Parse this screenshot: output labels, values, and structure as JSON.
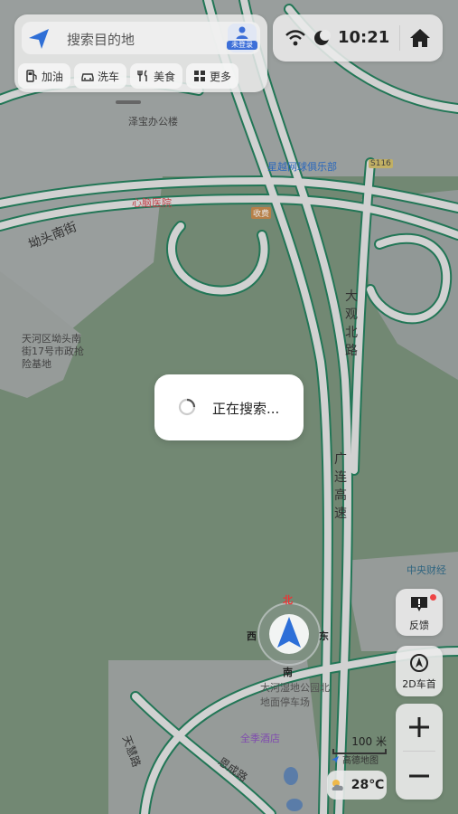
{
  "search": {
    "placeholder": "搜索目的地",
    "avatar_badge": "未登录"
  },
  "categories": [
    {
      "label": "加油",
      "icon": "fuel-icon"
    },
    {
      "label": "洗车",
      "icon": "car-wash-icon"
    },
    {
      "label": "美食",
      "icon": "food-icon"
    },
    {
      "label": "更多",
      "icon": "more-grid-icon"
    }
  ],
  "status": {
    "time": "10:21"
  },
  "loading": {
    "text": "正在搜索..."
  },
  "side": {
    "feedback": "反馈",
    "car_heading": "2D车首"
  },
  "compass": {
    "north": "北",
    "south": "南",
    "west": "西",
    "east": "东"
  },
  "scale": {
    "value": "100 米"
  },
  "brand": "高德地图",
  "weather": {
    "temp": "28℃"
  },
  "map_labels": {
    "zebao": "泽宝办公楼",
    "star_tennis": "星越网球俱乐部",
    "hospital": "心脑医院",
    "road_s116": "S116",
    "exit": "收费",
    "aotou_street": "坳头南街",
    "poi_dept": "天河区坳头南街17号市政抢险基地",
    "daguan_north": "大观北路",
    "guanglian": "广连高速",
    "central_finance": "中央财经",
    "parking": "大河湿地公园北地面停车场",
    "hotel": "全季酒店",
    "tianhui_road": "天慧路",
    "enchen_road": "恩成路"
  },
  "colors": {
    "road_stroke": "#1f7f5a",
    "road_fill": "#e6e6e6",
    "green": "#748f77",
    "gray": "#a8acab",
    "accent": "#3d6fd8"
  }
}
